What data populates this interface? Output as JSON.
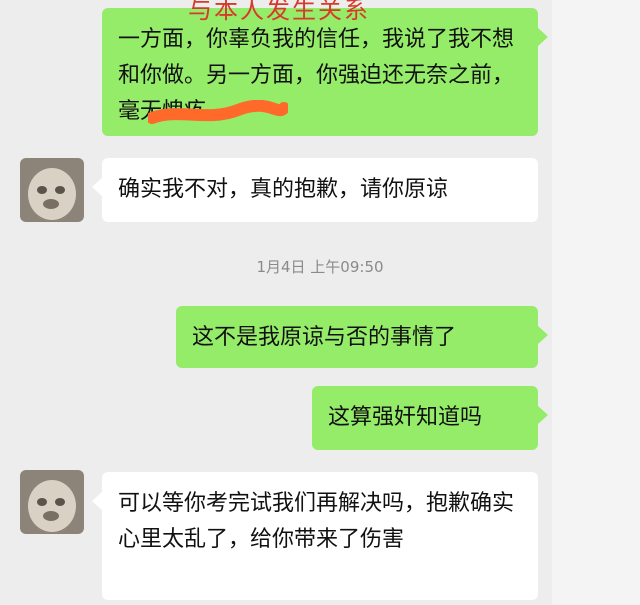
{
  "overlay": {
    "text": "与本人发生关系"
  },
  "messages": [
    {
      "sender": "me",
      "text": "一方面，你辜负我的信任，我说了我不想和你做。另一方面，你强迫还无奈之前，毫无愧疚。"
    },
    {
      "sender": "other",
      "text": "确实我不对，真的抱歉，请你原谅"
    },
    {
      "sender": "me",
      "text": "这不是我原谅与否的事情了"
    },
    {
      "sender": "me",
      "text": "这算强奸知道吗"
    },
    {
      "sender": "other",
      "text": "可以等你考完试我们再解决吗，抱歉确实心里太乱了，给你带来了伤害"
    }
  ],
  "timestamp": "1月4日 上午09:50",
  "colors": {
    "my_bubble": "#95ec69",
    "other_bubble": "#ffffff",
    "background": "#ededed",
    "overlay_text": "#d63a2a",
    "redaction": "#ff6a2b"
  }
}
